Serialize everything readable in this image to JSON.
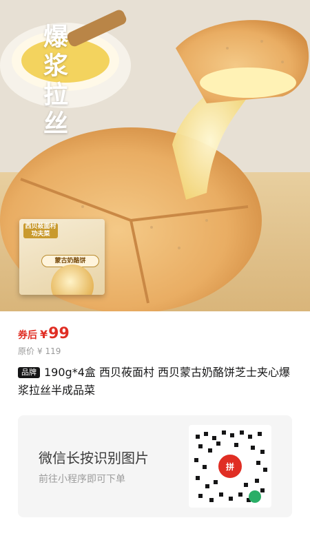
{
  "hero": {
    "slogan": "爆浆拉丝",
    "box_brand": "西贝莜面村",
    "box_brand_sub": "功夫菜",
    "box_product": "蒙古奶酪饼"
  },
  "price": {
    "coupon_label": "券后",
    "currency": "¥",
    "value": "99",
    "original_label": "原价",
    "original_value": "¥ 119"
  },
  "product": {
    "tag": "品牌",
    "title": "190g*4盒 西贝莜面村 西贝蒙古奶酪饼芝士夹心爆浆拉丝半成品菜"
  },
  "qr_card": {
    "main_text": "微信长按识别图片",
    "sub_text": "前往小程序即可下单",
    "logo_text": "拼"
  },
  "colors": {
    "accent": "#e02e24",
    "grey_text": "#999999",
    "card_bg": "#f5f5f5"
  }
}
